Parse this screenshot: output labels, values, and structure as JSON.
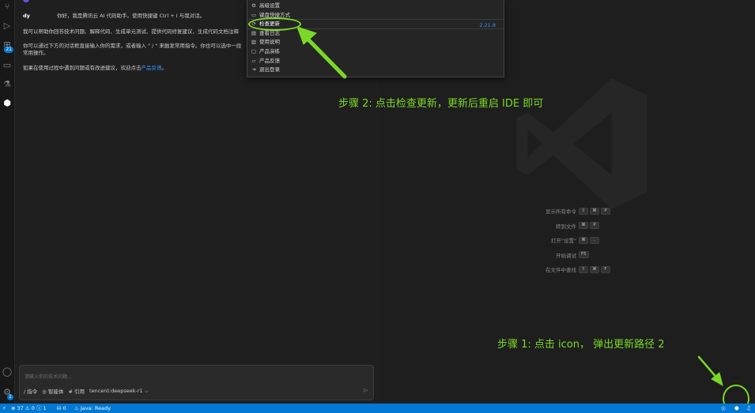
{
  "chat": {
    "greeting_name": "dy",
    "greeting": "你好，我是腾讯云 AI 代码助手。使用快捷键 Ctrl + I 与我对话。",
    "line2": "我可以帮助你回答技术问题、解释代码、生成单元测试、提供代码修复建议、生成代码文档注释",
    "line3a": "你可以通过下方的对话框直接输入你的需求，或者输入 \" / \" 来触发常用指令。你也可以选中一段",
    "line3b": "常用操作。",
    "line4_prefix": "如果在使用过程中遇到问题或有改进建议，欢迎点击",
    "line4_link": "产品反馈",
    "line4_suffix": "。",
    "input_placeholder": "请输入你的技术问题...",
    "tool_command": "/ 指令",
    "tool_agent": "◎ 智能体",
    "tool_ref": "# 引用",
    "model": "tencent:deepseek-r1 ⌵",
    "send_icon": "⊳"
  },
  "menu": {
    "items": [
      {
        "icon": "⚙",
        "label": "高级设置"
      },
      {
        "icon": "▭",
        "label": "键盘快捷方式"
      },
      {
        "icon": "⟳",
        "label": "检查更新"
      },
      {
        "icon": "▤",
        "label": "查看日志"
      },
      {
        "icon": "▥",
        "label": "使用说明"
      },
      {
        "icon": "▢",
        "label": "产品演练"
      },
      {
        "icon": "▱",
        "label": "产品反馈"
      },
      {
        "icon": "⇥",
        "label": "退出登录"
      }
    ],
    "version": "2.21.8"
  },
  "annotations": {
    "step2": "步骤 2: 点击检查更新，更新后重启 IDE 即可",
    "step1": "步骤 1: 点击 icon， 弹出更新路径 2"
  },
  "shortcuts": [
    {
      "label": "显示所有命令",
      "keys": [
        "⇧",
        "⌘",
        "P"
      ]
    },
    {
      "label": "转到文件",
      "keys": [
        "⌘",
        "P"
      ]
    },
    {
      "label": "打开\"设置\"",
      "keys": [
        "⌘",
        ","
      ]
    },
    {
      "label": "开始调试",
      "keys": [
        "F5"
      ]
    },
    {
      "label": "在文件中查找",
      "keys": [
        "⇧",
        "⌘",
        "F"
      ]
    }
  ],
  "activity": {
    "badge1": "21",
    "badge2": "1"
  },
  "status": {
    "remote": "⚡",
    "problems": "⊗ 37 ⚠ 0 ⓘ 1",
    "ports": "⛁ 0",
    "java": "♨ Java: Ready"
  },
  "colors": {
    "accent": "#0078d4",
    "annotation": "#7bd826",
    "link": "#3794ff"
  }
}
